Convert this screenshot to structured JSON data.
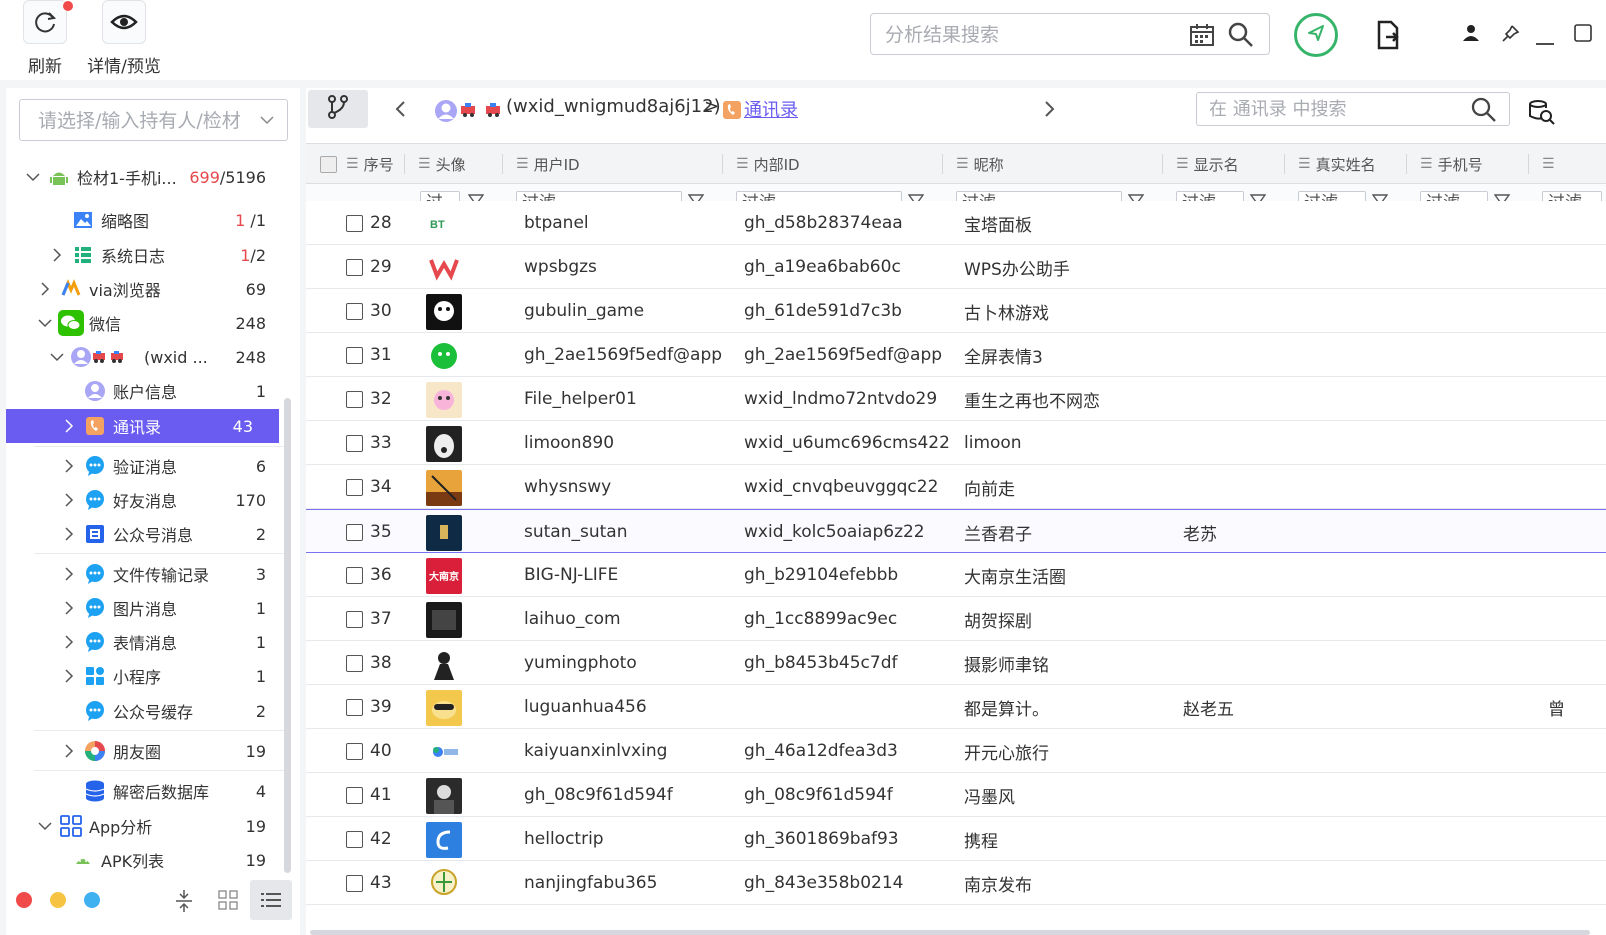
{
  "toolbar": {
    "refresh_label": "刷新",
    "preview_label": "详情/预览",
    "search_placeholder": "分析结果搜索"
  },
  "sidebar": {
    "holder_placeholder": "请选择/输入持有人/检材",
    "items": [
      {
        "label": "检材1-手机i...",
        "count_red": "699",
        "count": "/5196"
      },
      {
        "label": "缩略图",
        "count_red": "1",
        "count": " /1"
      },
      {
        "label": "系统日志",
        "count_red": "1",
        "count": "/2"
      },
      {
        "label": "via浏览器",
        "count": "69"
      },
      {
        "label": "微信",
        "count": "248"
      },
      {
        "label": "(wxid ...",
        "count": "248"
      },
      {
        "label": "账户信息",
        "count": "1"
      },
      {
        "label": "通讯录",
        "count": "43"
      },
      {
        "label": "验证消息",
        "count": "6"
      },
      {
        "label": "好友消息",
        "count": "170"
      },
      {
        "label": "公众号消息",
        "count": "2"
      },
      {
        "label": "文件传输记录",
        "count": "3"
      },
      {
        "label": "图片消息",
        "count": "1"
      },
      {
        "label": "表情消息",
        "count": "1"
      },
      {
        "label": "小程序",
        "count": "1"
      },
      {
        "label": "公众号缓存",
        "count": "2"
      },
      {
        "label": "朋友圈",
        "count": "19"
      },
      {
        "label": "解密后数据库",
        "count": "4"
      },
      {
        "label": "App分析",
        "count": "19"
      },
      {
        "label": "APK列表",
        "count": "19"
      }
    ]
  },
  "breadcrumb": {
    "account": "(wxid_wnigmud8aj6j12)",
    "sep": ">",
    "current": "通讯录"
  },
  "table_search_placeholder": "在 通讯录 中搜索",
  "table": {
    "columns": [
      "序号",
      "头像",
      "用户ID",
      "内部ID",
      "昵称",
      "显示名",
      "真实姓名",
      "手机号"
    ],
    "filter_label": "过滤",
    "rows": [
      {
        "no": "28",
        "user_id": "btpanel",
        "inner_id": "gh_d58b28374eaa",
        "nick": "宝塔面板",
        "display": "",
        "extra": ""
      },
      {
        "no": "29",
        "user_id": "wpsbgzs",
        "inner_id": "gh_a19ea6bab60c",
        "nick": "WPS办公助手",
        "display": "",
        "extra": ""
      },
      {
        "no": "30",
        "user_id": "gubulin_game",
        "inner_id": "gh_61de591d7c3b",
        "nick": "古卜林游戏",
        "display": "",
        "extra": ""
      },
      {
        "no": "31",
        "user_id": "gh_2ae1569f5edf@app",
        "inner_id": "gh_2ae1569f5edf@app",
        "nick": "全屏表情3",
        "display": "",
        "extra": ""
      },
      {
        "no": "32",
        "user_id": "File_helper01",
        "inner_id": "wxid_lndmo72ntvdo29",
        "nick": "重生之再也不网恋",
        "display": "",
        "extra": ""
      },
      {
        "no": "33",
        "user_id": "limoon890",
        "inner_id": "wxid_u6umc696cms422",
        "nick": "limoon",
        "display": "",
        "extra": ""
      },
      {
        "no": "34",
        "user_id": "whysnswy",
        "inner_id": "wxid_cnvqbeuvggqc22",
        "nick": "向前走",
        "display": "",
        "extra": ""
      },
      {
        "no": "35",
        "user_id": "sutan_sutan",
        "inner_id": "wxid_kolc5oaiap6z22",
        "nick": "兰香君子",
        "display": "老苏",
        "extra": ""
      },
      {
        "no": "36",
        "user_id": "BIG-NJ-LIFE",
        "inner_id": "gh_b29104efebbb",
        "nick": "大南京生活圈",
        "display": "",
        "extra": ""
      },
      {
        "no": "37",
        "user_id": "laihuo_com",
        "inner_id": "gh_1cc8899ac9ec",
        "nick": "胡贺探剧",
        "display": "",
        "extra": ""
      },
      {
        "no": "38",
        "user_id": "yumingphoto",
        "inner_id": "gh_b8453b45c7df",
        "nick": "摄影师聿铭",
        "display": "",
        "extra": ""
      },
      {
        "no": "39",
        "user_id": "luguanhua456",
        "inner_id": "",
        "nick": "都是算计。",
        "display": "赵老五",
        "extra": "曾"
      },
      {
        "no": "40",
        "user_id": "kaiyuanxinlvxing",
        "inner_id": "gh_46a12dfea3d3",
        "nick": "开元心旅行",
        "display": "",
        "extra": ""
      },
      {
        "no": "41",
        "user_id": "gh_08c9f61d594f",
        "inner_id": "gh_08c9f61d594f",
        "nick": "冯墨风",
        "display": "",
        "extra": ""
      },
      {
        "no": "42",
        "user_id": "helloctrip",
        "inner_id": "gh_3601869baf93",
        "nick": "携程",
        "display": "",
        "extra": ""
      },
      {
        "no": "43",
        "user_id": "nanjingfabu365",
        "inner_id": "gh_843e358b0214",
        "nick": "南京发布",
        "display": "",
        "extra": ""
      }
    ],
    "highlight_row": "35"
  },
  "colors": {
    "accent": "#6a5cf0",
    "count_red": "#e5484d",
    "green": "#36b56a"
  },
  "icons": [
    "refresh-icon",
    "eye-icon",
    "calendar-icon",
    "search-icon",
    "location-icon",
    "file-export-icon",
    "user-icon",
    "pin-icon",
    "minimize-icon",
    "maximize-icon",
    "branch-icon",
    "contacts-icon",
    "filter-icon"
  ]
}
